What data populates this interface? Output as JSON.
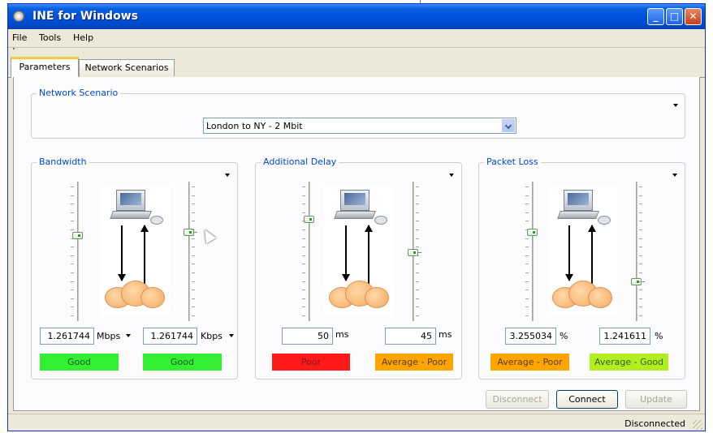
{
  "window": {
    "title": "INE for Windows"
  },
  "title_buttons": {
    "minimize": "_",
    "maximize": "□",
    "close": "✕"
  },
  "menu": [
    "File",
    "Tools",
    "Help"
  ],
  "tabs": [
    {
      "label": "Parameters",
      "active": true
    },
    {
      "label": "Network Scenarios",
      "active": false
    }
  ],
  "network_scenario": {
    "legend": "Network Scenario",
    "selected": "London to NY - 2 Mbit"
  },
  "bandwidth": {
    "legend": "Bandwidth",
    "left": {
      "value": "1.261744",
      "unit": "Mbps",
      "status": "Good",
      "status_color": "#33ee33"
    },
    "right": {
      "value": "1.261744",
      "unit": "Kbps",
      "status": "Good",
      "status_color": "#33ee33"
    }
  },
  "delay": {
    "legend": "Additional Delay",
    "left": {
      "value": "50",
      "unit": "ms",
      "status": "Poor",
      "status_color": "#ff1a1a"
    },
    "right": {
      "value": "45",
      "unit": "ms",
      "status": "Average - Poor",
      "status_color": "#ffa500"
    }
  },
  "packet_loss": {
    "legend": "Packet Loss",
    "left": {
      "value": "3.255034",
      "unit": "%",
      "status": "Average - Poor",
      "status_color": "#ffa500"
    },
    "right": {
      "value": "1.241611",
      "unit": "%",
      "status": "Average - Good",
      "status_color": "#b3ee22"
    }
  },
  "buttons": {
    "disconnect": "Disconnect",
    "connect": "Connect",
    "update": "Update"
  },
  "statusbar": {
    "text": "Disconnected"
  },
  "icons": [
    "app-icon",
    "computer-icon",
    "cloud-icon",
    "arrow-down-icon",
    "arrow-up-icon",
    "dropdown-caret-icon",
    "mouse-cursor-icon"
  ]
}
